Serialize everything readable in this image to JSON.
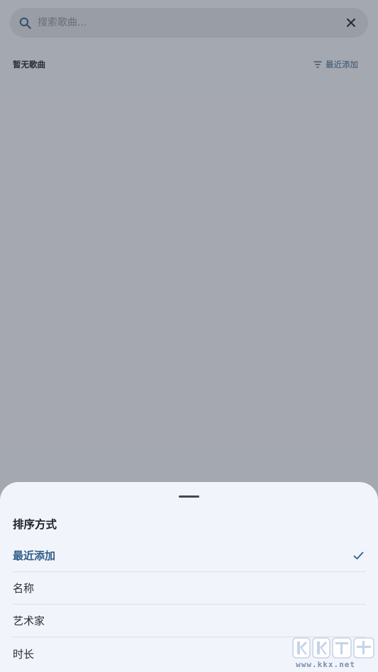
{
  "search": {
    "placeholder": "搜索歌曲..."
  },
  "list": {
    "empty_label": "暂无歌曲",
    "sort_label": "最近添加"
  },
  "sort_sheet": {
    "title": "排序方式",
    "options": [
      {
        "label": "最近添加",
        "selected": true
      },
      {
        "label": "名称",
        "selected": false
      },
      {
        "label": "艺术家",
        "selected": false
      },
      {
        "label": "时长",
        "selected": false
      }
    ]
  },
  "watermark": {
    "logo_text": "KK下载",
    "url": "www.kkx.net"
  },
  "colors": {
    "accent": "#2f5d89",
    "sheet_bg": "#f1f4fb",
    "search_bg": "#dde2ea"
  },
  "icons": {
    "search": "search-icon",
    "clear": "close-icon",
    "sort": "filter-icon",
    "selected": "check-icon"
  }
}
